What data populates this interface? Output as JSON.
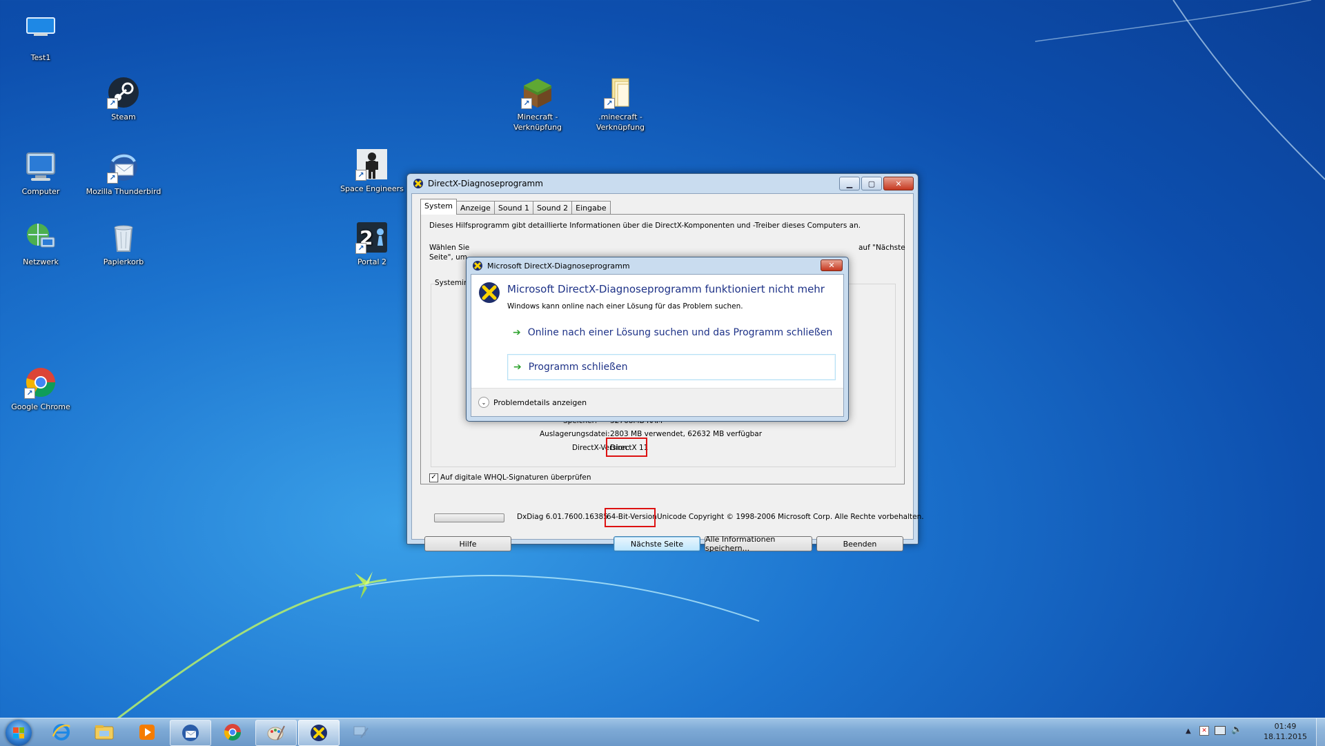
{
  "desktop": {
    "icons": [
      {
        "label": "Test1",
        "icon": "monitor-icon"
      },
      {
        "label": "Steam",
        "icon": "steam-icon"
      },
      {
        "label": "Computer",
        "icon": "computer-icon"
      },
      {
        "label": "Mozilla Thunderbird",
        "icon": "thunderbird-icon"
      },
      {
        "label": "Netzwerk",
        "icon": "network-icon"
      },
      {
        "label": "Papierkorb",
        "icon": "recycle-bin-icon"
      },
      {
        "label": "Google Chrome",
        "icon": "chrome-icon"
      },
      {
        "label": "Minecraft - Verknüpfung",
        "icon": "minecraft-icon"
      },
      {
        "label": ".minecraft - Verknüpfung",
        "icon": "folder-icon"
      },
      {
        "label": "Space Engineers",
        "icon": "space-engineers-icon"
      },
      {
        "label": "Portal 2",
        "icon": "portal2-icon"
      }
    ]
  },
  "dxdiag": {
    "title": "DirectX-Diagnoseprogramm",
    "tabs": [
      "System",
      "Anzeige",
      "Sound 1",
      "Sound 2",
      "Eingabe"
    ],
    "intro": "Dieses Hilfsprogramm gibt detaillierte Informationen über die DirectX-Komponenten und -Treiber dieses Computers an.",
    "select_line1_start": "Wählen Sie",
    "select_line1_end": "auf \"Nächste",
    "select_line2": "Seite\", um",
    "group_label": "Systemin",
    "rows": [
      {
        "label": "Speicher:",
        "value": "32768MB RAM"
      },
      {
        "label": "Auslagerungsdatei:",
        "value": "2803 MB verwendet, 62632 MB verfügbar"
      },
      {
        "label": "DirectX-Version:",
        "value": "DirectX 11"
      }
    ],
    "whql_label": "Auf digitale WHQL-Signaturen überprüfen",
    "whql_checked": "✓",
    "version_prefix": "DxDiag 6.01.7600.16385",
    "version_bits": "64-Bit-Version",
    "version_suffix": "Unicode Copyright © 1998-2006 Microsoft Corp. Alle Rechte vorbehalten.",
    "buttons": {
      "help": "Hilfe",
      "next": "Nächste Seite",
      "save": "Alle Informationen speichern...",
      "exit": "Beenden"
    }
  },
  "error_dialog": {
    "title": "Microsoft DirectX-Diagnoseprogramm",
    "heading": "Microsoft DirectX-Diagnoseprogramm funktioniert nicht mehr",
    "subtext": "Windows kann online nach einer Lösung für das Problem suchen.",
    "option_online": "Online nach einer Lösung suchen und das Programm schließen",
    "option_close": "Programm schließen",
    "details": "Problemdetails anzeigen"
  },
  "taskbar": {
    "items": [
      "internet-explorer-icon",
      "explorer-icon",
      "media-player-icon",
      "thunderbird-icon",
      "chrome-icon",
      "paint-icon",
      "dxdiag-icon",
      "network-app-icon"
    ],
    "time": "01:49",
    "date": "18.11.2015"
  }
}
